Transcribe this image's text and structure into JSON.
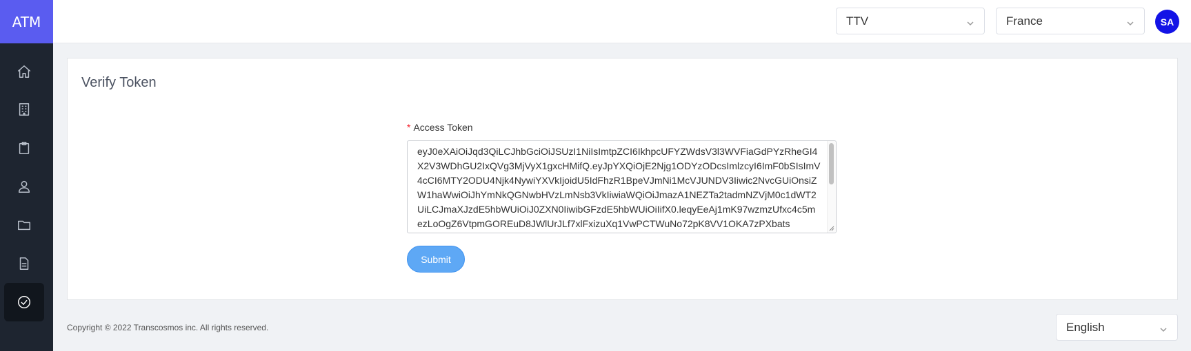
{
  "app": {
    "logo": "ATM"
  },
  "sidebar": {
    "items": [
      {
        "icon": "home-icon",
        "active": false
      },
      {
        "icon": "building-icon",
        "active": false
      },
      {
        "icon": "clipboard-icon",
        "active": false
      },
      {
        "icon": "user-icon",
        "active": false
      },
      {
        "icon": "folder-icon",
        "active": false
      },
      {
        "icon": "document-icon",
        "active": false
      },
      {
        "icon": "check-circle-icon",
        "active": true
      }
    ]
  },
  "header": {
    "project_select": "TTV",
    "country_select": "France",
    "avatar_initials": "SA"
  },
  "main": {
    "title": "Verify Token",
    "access_token": {
      "required_marker": "*",
      "label": "Access Token",
      "value": "eyJ0eXAiOiJqd3QiLCJhbGciOiJSUzI1NiIsImtpZCI6IkhpcUFYZWdsV3l3WVFiaGdPYzRheGI4X2V3WDhGU2IxQVg3MjVyX1gxcHMifQ.eyJpYXQiOjE2Njg1ODYzODcsImlzcyI6ImF0bSIsImV4cCI6MTY2ODU4Njk4NywiYXVkIjoidU5IdFhzR1BpeVJmNi1McVJUNDV3Iiwic2NvcGUiOnsiZW1haWwiOiJhYmNkQGNwbHVzLmNsb3VkIiwiaWQiOiJmazA1NEZTa2tadmNZVjM0c1dWT2UiLCJmaXJzdE5hbWUiOiJ0ZXN0IiwibGFzdE5hbWUiOiIifX0.leqyEeAj1mK97wzmzUfxc4c5mezLoOgZ6VtpmGOREuD8JWlUrJLf7xlFxizuXq1VwPCTWuNo72pK8VV1OKA7zPXbats"
    },
    "submit_label": "Submit"
  },
  "footer": {
    "copyright": "Copyright © 2022 Transcosmos inc. All rights reserved.",
    "language_select": "English"
  }
}
